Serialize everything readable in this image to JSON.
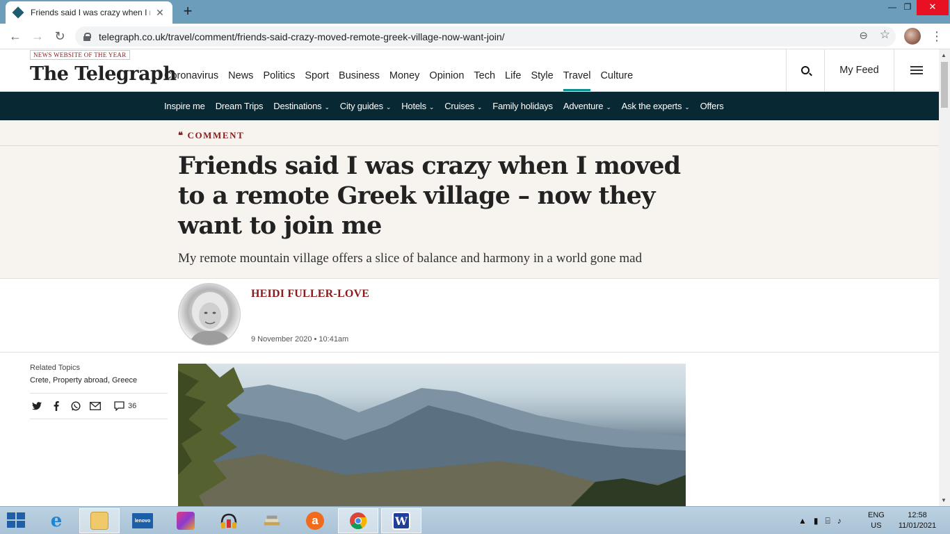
{
  "browser": {
    "tab_title": "Friends said I was crazy when I moved to a remote Greek village – now they want to join me",
    "tab_close": "✕",
    "new_tab": "+",
    "url": "telegraph.co.uk/travel/comment/friends-said-crazy-moved-remote-greek-village-now-want-join/",
    "window_min": "—",
    "window_max": "❐",
    "window_close": "✕",
    "back": "←",
    "forward": "→",
    "reload": "↻",
    "zoom": "⊖",
    "bookmark": "☆",
    "menu": "⋮"
  },
  "masthead": {
    "award": "NEWS WEBSITE OF THE YEAR",
    "logo": "The Telegraph",
    "nav": [
      "Coronavirus",
      "News",
      "Politics",
      "Sport",
      "Business",
      "Money",
      "Opinion",
      "Tech",
      "Life",
      "Style",
      "Travel",
      "Culture"
    ],
    "active_nav": "Travel",
    "my_feed": "My Feed"
  },
  "subnav": {
    "items": [
      {
        "label": "Inspire me",
        "dropdown": false
      },
      {
        "label": "Dream Trips",
        "dropdown": false
      },
      {
        "label": "Destinations",
        "dropdown": true
      },
      {
        "label": "City guides",
        "dropdown": true
      },
      {
        "label": "Hotels",
        "dropdown": true
      },
      {
        "label": "Cruises",
        "dropdown": true
      },
      {
        "label": "Family holidays",
        "dropdown": false
      },
      {
        "label": "Adventure",
        "dropdown": true
      },
      {
        "label": "Ask the experts",
        "dropdown": true
      },
      {
        "label": "Offers",
        "dropdown": false
      }
    ],
    "chevron": "⌄"
  },
  "article": {
    "kicker_mark": "❝",
    "kicker": "COMMENT",
    "headline": "Friends said I was crazy when I moved to a remote Greek village – now they want to join me",
    "standfirst": "My remote mountain village offers a slice of balance and harmony in a world gone mad",
    "author": "HEIDI FULLER-LOVE",
    "date": "9 November 2020 • 10:41am"
  },
  "sidebar": {
    "related_label": "Related Topics",
    "related_links": "Crete, Property abroad, Greece",
    "comment_count": "36"
  },
  "taskbar": {
    "apps": [
      "internet-explorer",
      "file-explorer",
      "lenovo",
      "app-manager",
      "audio",
      "books",
      "avast",
      "chrome",
      "word"
    ],
    "active_apps": [
      "file-explorer",
      "chrome"
    ],
    "word_letter": "W",
    "avast_letter": "a",
    "lenovo_label": "lenovo",
    "lang": "ENG",
    "region": "US",
    "time": "12:58",
    "date": "11/01/2021"
  },
  "colors": {
    "accent_teal": "#0e8f8f",
    "subnav_bg": "#082833",
    "kicker_red": "#8b1a1a",
    "header_bg": "#f7f4ef"
  }
}
